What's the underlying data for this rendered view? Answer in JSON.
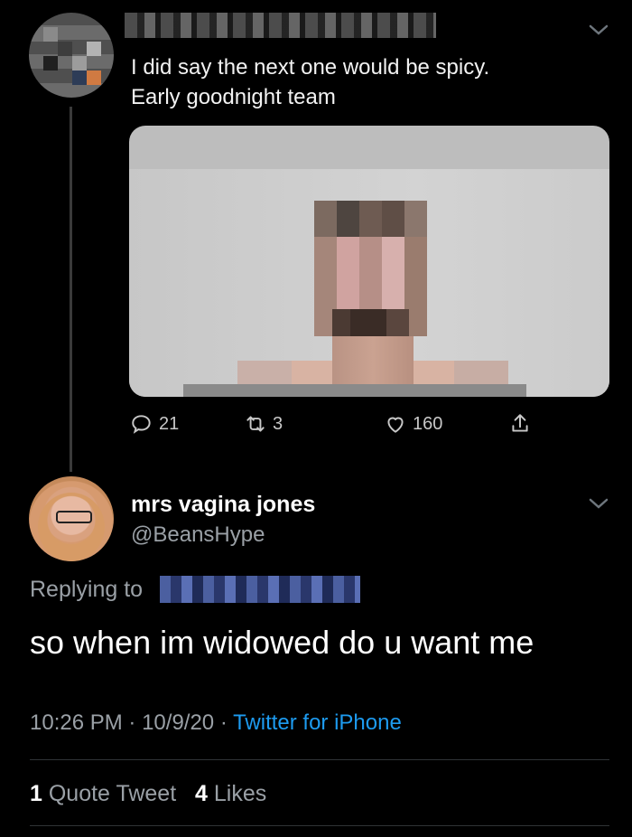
{
  "original_tweet": {
    "text_line1": "I did say the next one would be spicy.",
    "text_line2": "Early goodnight team",
    "actions": {
      "reply_count": "21",
      "retweet_count": "3",
      "like_count": "160"
    }
  },
  "reply_tweet": {
    "display_name": "mrs vagina jones",
    "handle": "@BeansHype",
    "replying_label": "Replying to",
    "text": "so when im widowed do u want me",
    "time": "10:26 PM",
    "date": "10/9/20",
    "source": "Twitter for iPhone",
    "quote_count": "1",
    "quote_label": "Quote Tweet",
    "like_count": "4",
    "like_label": "Likes"
  },
  "icons": [
    "reply-icon",
    "retweet-icon",
    "like-icon",
    "share-icon",
    "chevron-down-icon"
  ],
  "colors": {
    "background": "#000000",
    "link": "#1d9bf0",
    "secondary_text": "#9aa0a6"
  }
}
